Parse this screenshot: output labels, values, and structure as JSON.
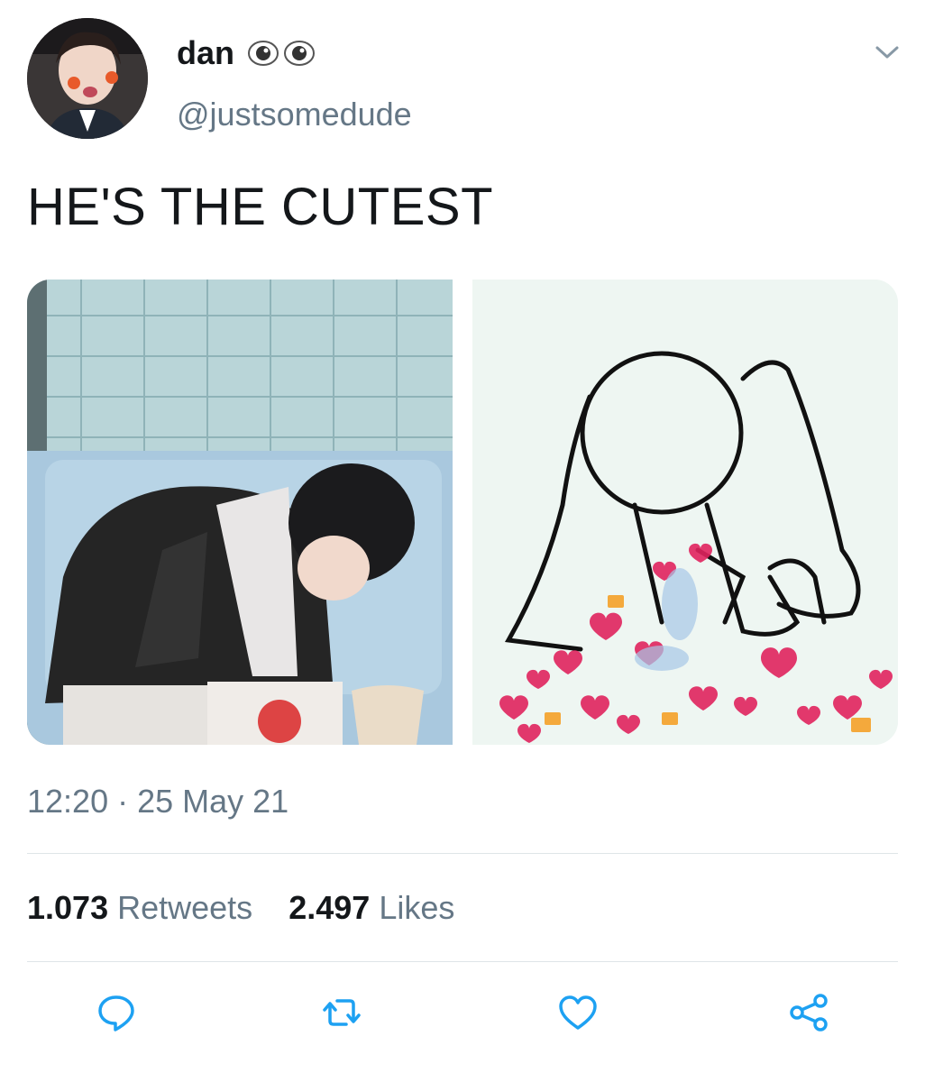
{
  "author": {
    "name": "dan",
    "emoji": "👁👁",
    "handle": "@justsomedude"
  },
  "tweet": {
    "text": "HE'S THE CUTEST",
    "timestamp": "12:20 · 25 May 21"
  },
  "stats": {
    "retweets_count": "1.073",
    "retweets_label": "Retweets",
    "likes_count": "2.497",
    "likes_label": "Likes"
  },
  "actions": [
    "reply-icon",
    "retweet-icon",
    "like-icon",
    "share-icon"
  ],
  "colors": {
    "text_primary": "#14171a",
    "text_secondary": "#657786",
    "divider": "#dfe5e8",
    "icon": "#1da1f2",
    "heart_red": "#e0245e"
  }
}
